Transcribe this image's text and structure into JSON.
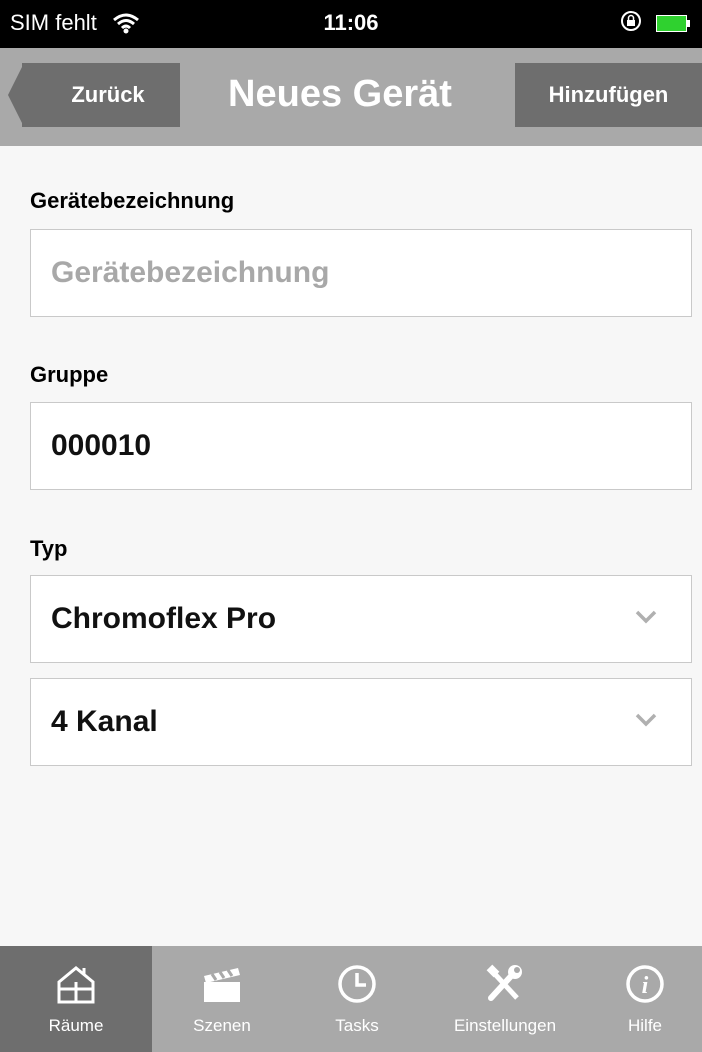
{
  "status_bar": {
    "carrier": "SIM fehlt",
    "time": "11:06"
  },
  "nav": {
    "back_label": "Zurück",
    "title": "Neues Gerät",
    "add_label": "Hinzufügen"
  },
  "form": {
    "name": {
      "label": "Gerätebezeichnung",
      "placeholder": "Gerätebezeichnung",
      "value": ""
    },
    "group": {
      "label": "Gruppe",
      "value": "000010"
    },
    "type": {
      "label": "Typ",
      "model_value": "Chromoflex Pro",
      "channel_value": "4 Kanal"
    }
  },
  "tabs": [
    {
      "label": "Räume",
      "icon": "house-icon",
      "active": true
    },
    {
      "label": "Szenen",
      "icon": "clapperboard-icon",
      "active": false
    },
    {
      "label": "Tasks",
      "icon": "clock-icon",
      "active": false
    },
    {
      "label": "Einstellungen",
      "icon": "tools-icon",
      "active": false
    },
    {
      "label": "Hilfe",
      "icon": "info-icon",
      "active": false
    }
  ],
  "colors": {
    "bar_gray": "#a9a9a9",
    "button_gray": "#6e6e6e",
    "background": "#f7f7f7"
  }
}
